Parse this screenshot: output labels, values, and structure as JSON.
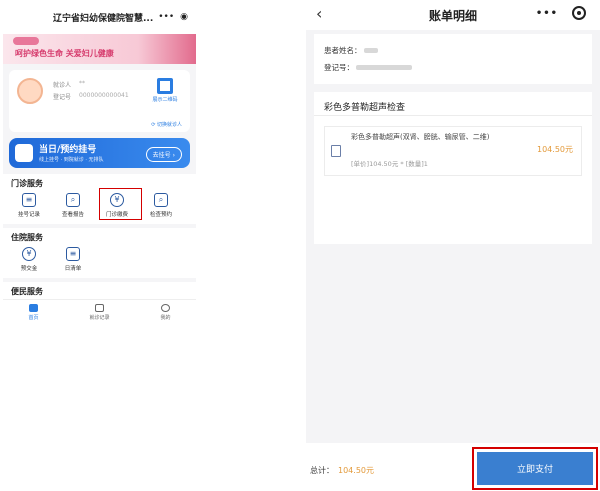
{
  "left": {
    "title": "辽宁省妇幼保健院智慧...",
    "slogan": "呵护绿色生命 关爱妇儿健康",
    "patient": {
      "name_label": "就诊人",
      "name_value": "**",
      "id_label": "登记号",
      "id_value": "0000000000041",
      "qr_label": "展示二维码",
      "switch_label": "切换就诊人"
    },
    "register": {
      "title": "当日/预约挂号",
      "subtitle": "线上挂号 · 到院就诊 · 无排队",
      "button": "去挂号"
    },
    "outpatient": {
      "title": "门诊服务",
      "items": [
        {
          "label": "挂号记录",
          "icon": "register-record-icon"
        },
        {
          "label": "查看报告",
          "icon": "report-icon"
        },
        {
          "label": "门诊缴费",
          "icon": "payment-icon"
        },
        {
          "label": "检查预约",
          "icon": "exam-booking-icon"
        }
      ]
    },
    "inpatient": {
      "title": "住院服务",
      "items": [
        {
          "label": "预交金",
          "icon": "deposit-icon"
        },
        {
          "label": "日清单",
          "icon": "daily-list-icon"
        }
      ]
    },
    "convenience": {
      "title": "便民服务"
    },
    "tabbar": [
      {
        "label": "首页"
      },
      {
        "label": "就诊记录"
      },
      {
        "label": "我的"
      }
    ]
  },
  "right": {
    "nav_title": "账单明细",
    "patient_name_label": "患者姓名：",
    "register_no_label": "登记号：",
    "section_title": "彩色多普勒超声检查",
    "item": {
      "name": "彩色多普勒超声(双肾、膀胱、输尿管、二维)",
      "price": "104.50元",
      "meta": "[单价]104.50元 * [数量]1"
    },
    "total_label": "总计：",
    "total_value": "104.50元",
    "pay_button": "立即支付"
  },
  "colors": {
    "accent_blue": "#2a7de1",
    "price_orange": "#e39a3b",
    "highlight_red": "#d40000"
  }
}
